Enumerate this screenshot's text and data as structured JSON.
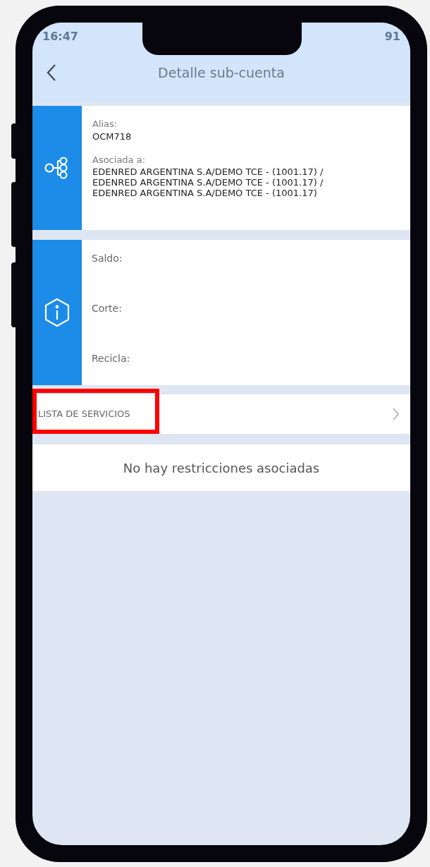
{
  "status_bar": {
    "time": "16:47",
    "battery": "91"
  },
  "header": {
    "title": "Detalle sub-cuenta"
  },
  "account_card": {
    "fields": [
      {
        "label": "Alias:",
        "value": "OCM718"
      },
      {
        "label": "Asociada a:",
        "value": "EDENRED ARGENTINA S.A/DEMO TCE - (1001.17) /\nEDENRED ARGENTINA S.A/DEMO TCE - (1001.17) /\nEDENRED ARGENTINA S.A/DEMO TCE - (1001.17)"
      }
    ]
  },
  "info_card": {
    "fields": [
      {
        "label": "Saldo:"
      },
      {
        "label": "Corte:"
      },
      {
        "label": "Recicla:"
      }
    ]
  },
  "services_row": {
    "label": "LISTA DE SERVICIOS",
    "highlighted": true
  },
  "message": "No hay restricciones asociadas"
}
